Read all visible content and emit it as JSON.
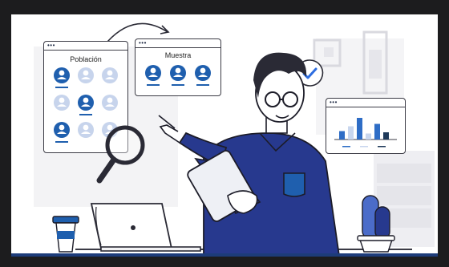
{
  "illustration": {
    "poblacion_title": "Población",
    "muestra_title": "Muestra",
    "window_dots": "•••",
    "colors": {
      "primary_blue": "#1f5fae",
      "light_blue": "#c7d4ec",
      "navy_sweater": "#27398e",
      "dark_ink": "#2a2a35",
      "cactus": "#4b6cc9",
      "check_blue": "#2d6de0"
    },
    "chart_widget": {
      "series": [
        {
          "color": "#2e6dc6",
          "value": 0.35
        },
        {
          "color": "#c8d6ee",
          "value": 0.55
        },
        {
          "color": "#2e6dc6",
          "value": 0.9
        },
        {
          "color": "#c8d6ee",
          "value": 0.25
        },
        {
          "color": "#2e6dc6",
          "value": 0.65
        },
        {
          "color": "#1f3a5a",
          "value": 0.3
        }
      ]
    }
  }
}
